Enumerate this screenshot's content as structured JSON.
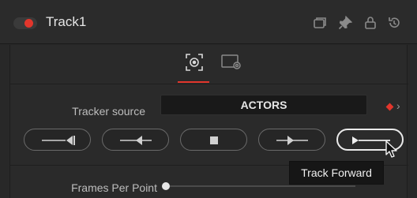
{
  "header": {
    "title": "Track1",
    "enabled": true,
    "icons": [
      "window-icon",
      "pin-icon",
      "lock-icon",
      "reset-icon"
    ]
  },
  "tabs": [
    {
      "name": "tracker-tab",
      "active": true
    },
    {
      "name": "settings-tab",
      "active": false
    }
  ],
  "tracker_source": {
    "label": "Tracker source",
    "value": "ACTORS"
  },
  "track_buttons": [
    {
      "name": "track-to-start",
      "icon": "track-to-start-icon"
    },
    {
      "name": "track-backward",
      "icon": "track-backward-icon"
    },
    {
      "name": "stop-tracking",
      "icon": "stop-icon"
    },
    {
      "name": "track-forward-step",
      "icon": "track-forward-step-icon"
    },
    {
      "name": "track-forward",
      "icon": "track-forward-icon",
      "active": true
    }
  ],
  "frames_per_point": {
    "label": "Frames Per Point",
    "value_fraction": 0
  },
  "tooltip": {
    "text": "Track Forward"
  },
  "colors": {
    "accent": "#e2362c",
    "panel_bg": "#282828",
    "field_bg": "#191919"
  }
}
